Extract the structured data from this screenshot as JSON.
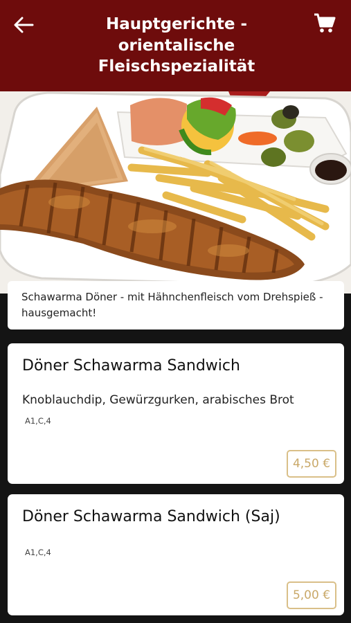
{
  "header": {
    "title": "Hauptgerichte - orientalische Fleischspezialität",
    "back_icon": "arrow-left-icon",
    "cart_icon": "shopping-cart-icon",
    "background_color": "#6e0c0c"
  },
  "hero": {
    "alt": "Schawarma Teller mit Pommes, Fladenbrot, Salat und Dip"
  },
  "category": {
    "description": "Schawarma Döner - mit Hähnchenfleisch vom Drehspieß - hausgemacht!"
  },
  "items": [
    {
      "name": "Döner Schawarma Sandwich",
      "description": "Knoblauchdip, Gewürzgurken, arabisches Brot",
      "allergens": "A1,C,4",
      "price": "4,50 €"
    },
    {
      "name": "Döner Schawarma Sandwich (Saj)",
      "description": "",
      "allergens": "A1,C,4",
      "price": "5,00 €"
    }
  ],
  "colors": {
    "accent_gold": "#c9a868",
    "page_background": "#141414"
  }
}
